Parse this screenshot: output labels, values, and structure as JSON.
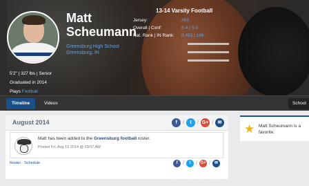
{
  "profile": {
    "first_name": "Matt",
    "last_name": "Scheumann",
    "school": "Greensburg High School",
    "location": "Greensburg, IN",
    "bio": {
      "measurements": "5'2\" | 327 lbs | Senior",
      "graduated": "Graduated in 2014",
      "plays_label": "Plays",
      "sport": "Football"
    }
  },
  "team": {
    "title": "13-14 Varsity Football",
    "stats": [
      {
        "label": "Jersey:",
        "value": "#63"
      },
      {
        "label": "Overall | Conf:",
        "value": "6-4 | 5-2"
      },
      {
        "label": "Nat. Rank | IN Rank:",
        "value": "8,453 | 186"
      }
    ]
  },
  "tabs": {
    "timeline": "Timeline",
    "videos": "Videos",
    "school": "School"
  },
  "timeline": {
    "month": "August 2014",
    "post": {
      "text_before": "Matt has been added to the ",
      "team_link": "Greensburg football",
      "text_after": " roster.",
      "date": "Posted Fri, Aug 15 2014 @ 03:07 AM"
    },
    "footer": {
      "roster": "Roster",
      "separator": "·",
      "schedule": "Schedule"
    }
  },
  "social": {
    "facebook": "f",
    "twitter": "t",
    "google": "G+",
    "email": "✉",
    "separator": "/"
  },
  "favorite": {
    "text": "Matt Scheumann is a favorite."
  },
  "colors": {
    "accent": "#1b4f8a",
    "link": "#6aa0d8",
    "star": "#f2b31a"
  }
}
